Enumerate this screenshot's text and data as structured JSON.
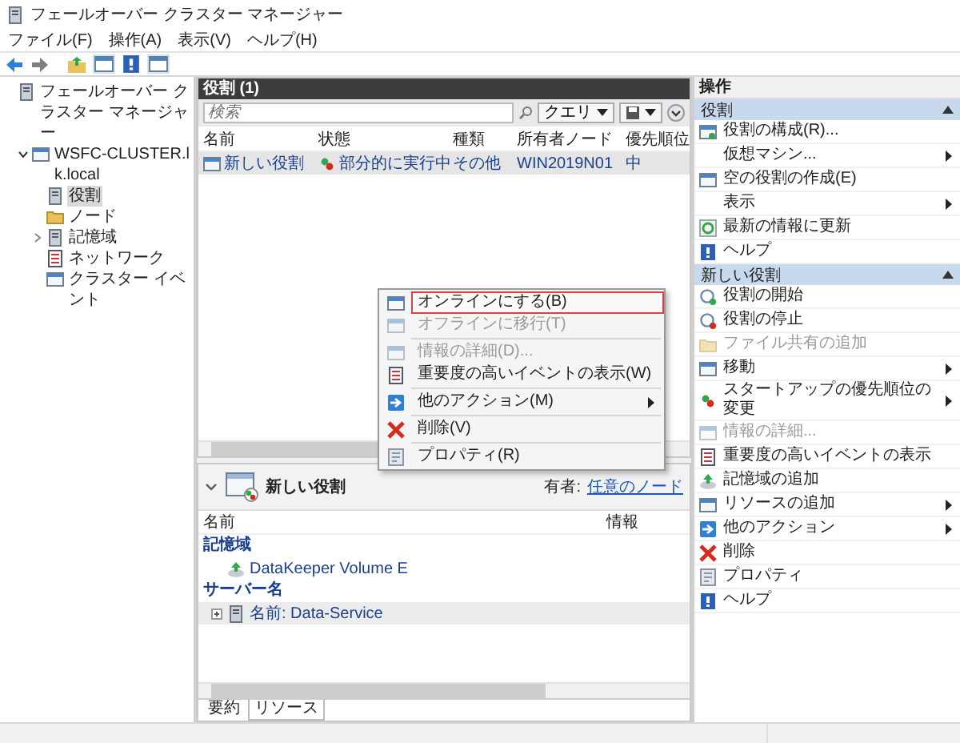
{
  "window": {
    "title": "フェールオーバー クラスター マネージャー"
  },
  "menu_bar": [
    "ファイル(F)",
    "操作(A)",
    "表示(V)",
    "ヘルプ(H)"
  ],
  "tree": [
    {
      "label": "フェールオーバー クラスター マネージャー",
      "selected": false,
      "children": [
        {
          "label": "WSFC-CLUSTER.lk.local",
          "expanded": true,
          "selected": false,
          "children": [
            {
              "label": "役割",
              "selected": true
            },
            {
              "label": "ノード",
              "selected": false
            },
            {
              "label": "記憶域",
              "expanded": false,
              "selected": false
            },
            {
              "label": "ネットワーク",
              "selected": false
            },
            {
              "label": "クラスター イベント",
              "selected": false
            }
          ]
        }
      ]
    }
  ],
  "roles_panel": {
    "title": "役割 (1)",
    "search": {
      "placeholder": "検索"
    },
    "query_button": "クエリ",
    "columns": [
      "名前",
      "状態",
      "種類",
      "所有者ノード",
      "優先順位"
    ],
    "rows": [
      {
        "cells": [
          "新しい役割",
          "部分的に実行中",
          "その他",
          "WIN2019N01",
          "中"
        ],
        "selected": true
      }
    ]
  },
  "detail_panel": {
    "title": "新しい役割",
    "expanded": true,
    "owner_label": "有者:",
    "owner_link": "任意のノード",
    "columns": [
      "名前",
      "情報"
    ],
    "rows": [
      {
        "kind": "group",
        "label": "記憶域"
      },
      {
        "kind": "item",
        "label": "DataKeeper Volume E"
      },
      {
        "kind": "group",
        "label": "サーバー名"
      },
      {
        "kind": "item",
        "label": "名前: Data-Service",
        "expandable": true
      }
    ],
    "tabs": [
      {
        "label": "要約",
        "selected": false
      },
      {
        "label": "リソース",
        "selected": true
      }
    ]
  },
  "context_menu": [
    {
      "kind": "item",
      "label": "オンラインにする(B)",
      "selected": true,
      "disabled": false
    },
    {
      "kind": "item",
      "label": "オフラインに移行(T)",
      "selected": false,
      "disabled": true
    },
    {
      "kind": "separator"
    },
    {
      "kind": "item",
      "label": "情報の詳細(D)...",
      "selected": false,
      "disabled": true
    },
    {
      "kind": "item",
      "label": "重要度の高いイベントの表示(W)",
      "selected": false,
      "disabled": false
    },
    {
      "kind": "separator"
    },
    {
      "kind": "item",
      "label": "他のアクション(M)",
      "selected": false,
      "disabled": false,
      "submenu": true
    },
    {
      "kind": "separator"
    },
    {
      "kind": "item",
      "label": "削除(V)",
      "selected": false,
      "disabled": false
    },
    {
      "kind": "separator"
    },
    {
      "kind": "item",
      "label": "プロパティ(R)",
      "selected": false,
      "disabled": false
    }
  ],
  "actions": {
    "title": "操作",
    "sections": [
      {
        "title": "役割",
        "expanded": true,
        "items": [
          {
            "label": "役割の構成(R)...",
            "disabled": false
          },
          {
            "label": "仮想マシン...",
            "disabled": false,
            "submenu": true
          },
          {
            "label": "空の役割の作成(E)",
            "disabled": false
          },
          {
            "label": "表示",
            "disabled": false,
            "submenu": true
          },
          {
            "label": "最新の情報に更新",
            "disabled": false
          },
          {
            "label": "ヘルプ",
            "disabled": false
          }
        ]
      },
      {
        "title": "新しい役割",
        "expanded": true,
        "items": [
          {
            "label": "役割の開始",
            "disabled": false
          },
          {
            "label": "役割の停止",
            "disabled": false
          },
          {
            "label": "ファイル共有の追加",
            "disabled": true
          },
          {
            "label": "移動",
            "disabled": false,
            "submenu": true
          },
          {
            "label": "スタートアップの優先順位の変更",
            "disabled": false,
            "submenu": true
          },
          {
            "label": "情報の詳細...",
            "disabled": true
          },
          {
            "label": "重要度の高いイベントの表示",
            "disabled": false
          },
          {
            "label": "記憶域の追加",
            "disabled": false
          },
          {
            "label": "リソースの追加",
            "disabled": false,
            "submenu": true
          },
          {
            "label": "他のアクション",
            "disabled": false,
            "submenu": true
          },
          {
            "label": "削除",
            "disabled": false
          },
          {
            "label": "プロパティ",
            "disabled": false
          },
          {
            "label": "ヘルプ",
            "disabled": false
          }
        ]
      }
    ]
  }
}
